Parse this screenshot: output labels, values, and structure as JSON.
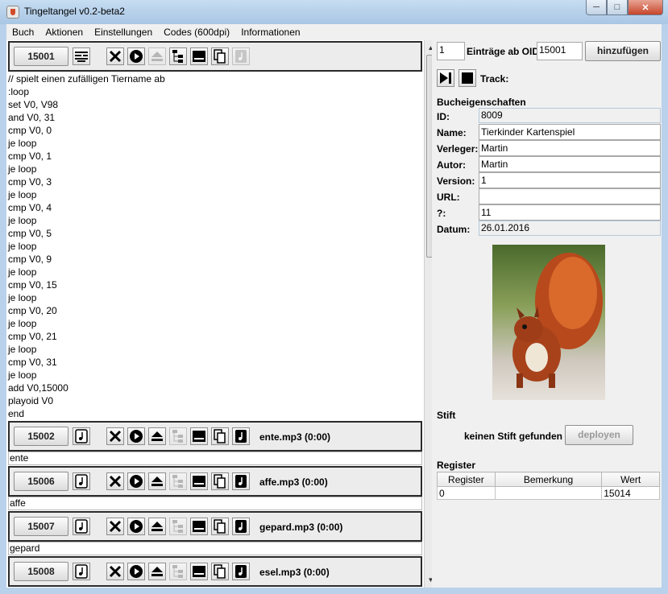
{
  "window": {
    "title": "Tingeltangel v0.2-beta2"
  },
  "menu": [
    "Buch",
    "Aktionen",
    "Einstellungen",
    "Codes (600dpi)",
    "Informationen"
  ],
  "script_chunk": {
    "oid": "15001",
    "lines": [
      "// spielt einen zufälligen Tiername ab",
      ":loop",
      "set V0, V98",
      "and V0, 31",
      "cmp V0, 0",
      "je loop",
      "cmp V0, 1",
      "je loop",
      "cmp V0, 3",
      "je loop",
      "cmp V0, 4",
      "je loop",
      "cmp V0, 5",
      "je loop",
      "cmp V0, 9",
      "je loop",
      "cmp V0, 15",
      "je loop",
      "cmp V0, 20",
      "je loop",
      "cmp V0, 21",
      "je loop",
      "cmp V0, 31",
      "je loop",
      "add V0,15000",
      "playoid V0",
      "end"
    ]
  },
  "audio_chunks": [
    {
      "oid": "15002",
      "file": "ente.mp3 (0:00)",
      "text": "ente"
    },
    {
      "oid": "15006",
      "file": "affe.mp3 (0:00)",
      "text": "affe"
    },
    {
      "oid": "15007",
      "file": "gepard.mp3 (0:00)",
      "text": "gepard"
    },
    {
      "oid": "15008",
      "file": "esel.mp3 (0:00)",
      "text": ""
    }
  ],
  "add_entries": {
    "count": "1",
    "label": "Einträge ab OID",
    "oid": "15001",
    "button": "hinzufügen"
  },
  "player": {
    "track_label": "Track:"
  },
  "book": {
    "section": "Bucheigenschaften",
    "id_label": "ID:",
    "id": "8009",
    "name_label": "Name:",
    "name": "Tierkinder Kartenspiel",
    "publisher_label": "Verleger:",
    "publisher": "Martin",
    "author_label": "Autor:",
    "author": "Martin",
    "version_label": "Version:",
    "version": "1",
    "url_label": "URL:",
    "url": "",
    "magic_label": "?:",
    "magic": "11",
    "date_label": "Datum:",
    "date": "26.01.2016"
  },
  "pen": {
    "section": "Stift",
    "status": "keinen Stift gefunden",
    "deploy": "deployen"
  },
  "register": {
    "section": "Register",
    "columns": [
      "Register",
      "Bemerkung",
      "Wert"
    ],
    "rows": [
      [
        "0",
        "",
        "15014"
      ]
    ]
  },
  "colors": {
    "titlebar": "#b9d1ea",
    "chunk_border": "#2b2b2b"
  }
}
